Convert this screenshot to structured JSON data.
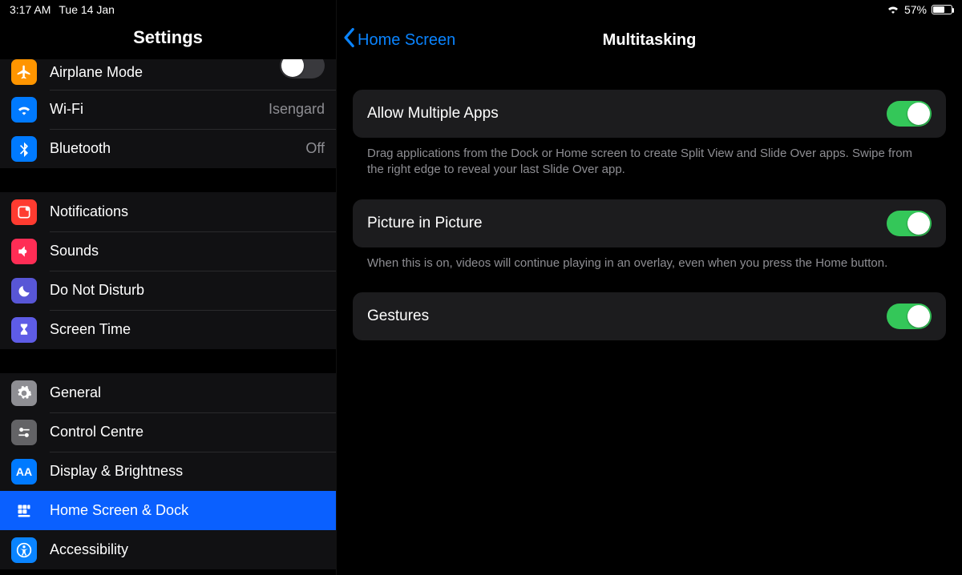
{
  "status": {
    "time": "3:17 AM",
    "date": "Tue 14 Jan",
    "battery_pct": "57%",
    "battery_fill_pct": 57
  },
  "sidebar": {
    "title": "Settings",
    "items": {
      "airplane": {
        "label": "Airplane Mode",
        "state": "off"
      },
      "wifi": {
        "label": "Wi-Fi",
        "value": "Isengard"
      },
      "bluetooth": {
        "label": "Bluetooth",
        "value": "Off"
      },
      "notifications": {
        "label": "Notifications"
      },
      "sounds": {
        "label": "Sounds"
      },
      "dnd": {
        "label": "Do Not Disturb"
      },
      "screentime": {
        "label": "Screen Time"
      },
      "general": {
        "label": "General"
      },
      "control": {
        "label": "Control Centre"
      },
      "display": {
        "label": "Display & Brightness",
        "aa": "AA"
      },
      "home": {
        "label": "Home Screen & Dock"
      },
      "accessibility": {
        "label": "Accessibility"
      }
    }
  },
  "detail": {
    "back_label": "Home Screen",
    "title": "Multitasking",
    "rows": {
      "multi": {
        "label": "Allow Multiple Apps",
        "desc": "Drag applications from the Dock or Home screen to create Split View and Slide Over apps. Swipe from the right edge to reveal your last Slide Over app.",
        "on": true
      },
      "pip": {
        "label": "Picture in Picture",
        "desc": "When this is on, videos will continue playing in an overlay, even when you press the Home button.",
        "on": true
      },
      "gestures": {
        "label": "Gestures",
        "on": true
      }
    }
  }
}
